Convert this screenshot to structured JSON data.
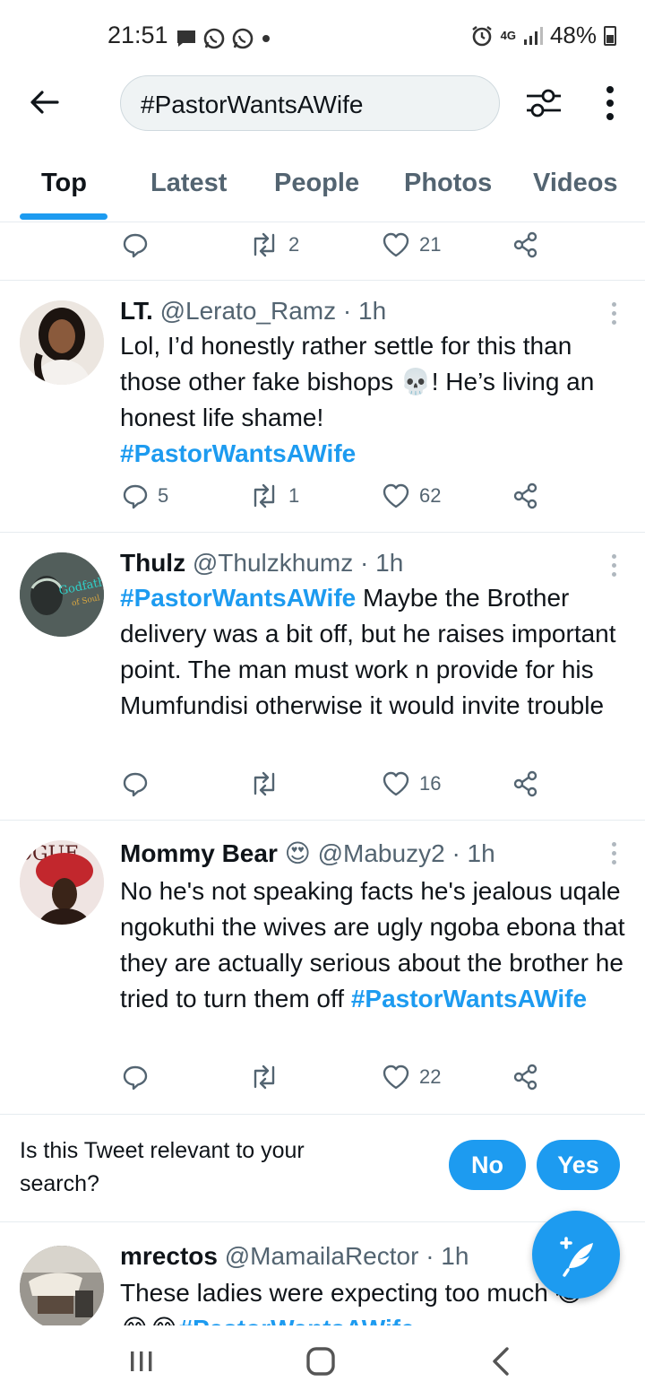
{
  "status_bar": {
    "time": "21:51",
    "network": "4G",
    "battery": "48%"
  },
  "header": {
    "search_query": "#PastorWantsAWife"
  },
  "tabs": [
    {
      "label": "Top",
      "active": true
    },
    {
      "label": "Latest",
      "active": false
    },
    {
      "label": "People",
      "active": false
    },
    {
      "label": "Photos",
      "active": false
    },
    {
      "label": "Videos",
      "active": false
    }
  ],
  "top_action_row": {
    "retweets": "2",
    "likes": "21"
  },
  "tweets": [
    {
      "name": "LT.",
      "handle": "@Lerato_Ramz",
      "time": "· 1h",
      "text_1": "Lol, I’d honestly rather settle for this than those other fake bishops ",
      "emoji_1": "💀",
      "text_2": "! He’s living an honest life shame!",
      "hashtag": "#PastorWantsAWife",
      "replies": "5",
      "retweets": "1",
      "likes": "62"
    },
    {
      "name": "Thulz",
      "handle": "@Thulzkhumz",
      "time": "· 1h",
      "hashtag": "#PastorWantsAWife",
      "text_1": " Maybe the Brother delivery was a bit off, but he raises important point. The man must work n provide for his Mumfundisi otherwise it would invite trouble",
      "avatar_caption_1": "Godfather",
      "avatar_caption_2": "of Soul",
      "replies": "",
      "retweets": "",
      "likes": "16"
    },
    {
      "name": "Mommy Bear",
      "name_emoji": "😍",
      "handle": "@Mabuzy2",
      "time": "· 1h",
      "text_1": "No he's not speaking facts he's jealous uqale ngokuthi the wives are ugly ngoba ebona that they are actually serious about the brother he tried to turn them off ",
      "hashtag": "#PastorWantsAWife",
      "avatar_caption": "OGUE",
      "replies": "",
      "retweets": "",
      "likes": "22"
    },
    {
      "name": "mrectos",
      "handle": "@MamailaRector",
      "time": "· 1h",
      "text_1": "These ladies were expecting too much ",
      "emoji_1": "😂",
      "emoji_2": "😂😂",
      "hashtag": "#PastorWantsAWife"
    }
  ],
  "relevance_prompt": {
    "question": "Is this Tweet relevant to your search?",
    "no_label": "No",
    "yes_label": "Yes"
  },
  "colors": {
    "accent": "#1d9bf0",
    "text": "#0f1419",
    "secondary_text": "#536471",
    "divider": "#e6ecf0"
  }
}
